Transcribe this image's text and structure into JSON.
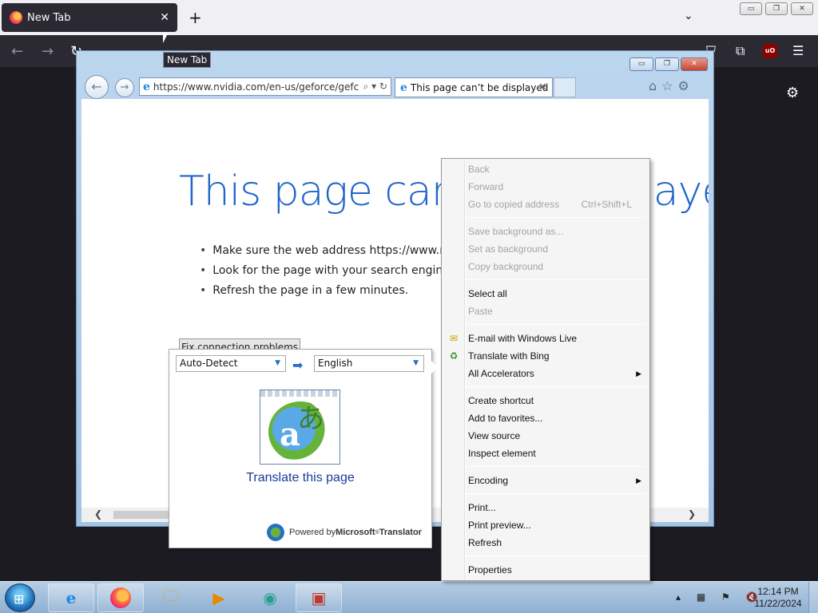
{
  "firefox": {
    "tab_title": "New Tab",
    "tooltip": "New Tab"
  },
  "ie": {
    "address_url": "https://www.nvidia.com/en-us/geforce/gefc",
    "tab_title": "This page can’t be displayed"
  },
  "error_page": {
    "title": "This page can’t be displayed",
    "bullets": [
      "Make sure the web address https://www.nv",
      "Look for the page with your search engine.",
      "Refresh the page in a few minutes."
    ],
    "fix_button": "Fix connection problems"
  },
  "translator": {
    "from_lang": "Auto-Detect",
    "to_lang": "English",
    "link": "Translate this page",
    "powered_prefix": "Powered by ",
    "brand": "Microsoft",
    "product": " Translator"
  },
  "context_menu": {
    "back": "Back",
    "forward": "Forward",
    "go_copied": "Go to copied address",
    "go_copied_shortcut": "Ctrl+Shift+L",
    "save_bg": "Save background as...",
    "set_bg": "Set as background",
    "copy_bg": "Copy background",
    "select_all": "Select all",
    "paste": "Paste",
    "email_live": "E-mail with Windows Live",
    "translate_bing": "Translate with Bing",
    "all_accel": "All Accelerators",
    "create_shortcut": "Create shortcut",
    "add_fav": "Add to favorites...",
    "view_source": "View source",
    "inspect": "Inspect element",
    "encoding": "Encoding",
    "print": "Print...",
    "print_preview": "Print preview...",
    "refresh": "Refresh",
    "properties": "Properties"
  },
  "taskbar": {
    "time": "12:14 PM",
    "date": "11/22/2024"
  },
  "icons": {
    "ff_new_tab": "plus-icon",
    "ie_logo": "internet-explorer-icon",
    "translator": "translator-icon"
  }
}
